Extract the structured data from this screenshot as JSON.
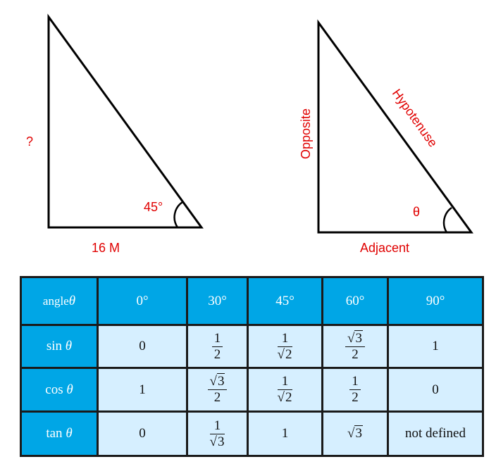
{
  "left_triangle": {
    "angle_label": "45°",
    "base_label": "16 M",
    "unknown_side_label": "?"
  },
  "right_triangle": {
    "angle_label": "θ",
    "opposite_label": "Opposite",
    "hypotenuse_label": "Hypotenuse",
    "adjacent_label": "Adjacent"
  },
  "table": {
    "header": {
      "corner": "angle",
      "corner_symbol": "θ",
      "angles": [
        "0°",
        "30°",
        "45°",
        "60°",
        "90°"
      ]
    },
    "rows": [
      {
        "fn": "sin",
        "symbol": "θ",
        "values": [
          {
            "type": "text",
            "text": "0"
          },
          {
            "type": "frac",
            "num": "1",
            "den": "2"
          },
          {
            "type": "frac",
            "num": "1",
            "den_sqrt": "2"
          },
          {
            "type": "frac",
            "num_sqrt": "3",
            "den": "2"
          },
          {
            "type": "text",
            "text": "1"
          }
        ]
      },
      {
        "fn": "cos",
        "symbol": "θ",
        "values": [
          {
            "type": "text",
            "text": "1"
          },
          {
            "type": "frac",
            "num_sqrt": "3",
            "den": "2"
          },
          {
            "type": "frac",
            "num": "1",
            "den_sqrt": "2"
          },
          {
            "type": "frac",
            "num": "1",
            "den": "2"
          },
          {
            "type": "text",
            "text": "0"
          }
        ]
      },
      {
        "fn": "tan",
        "symbol": "θ",
        "values": [
          {
            "type": "text",
            "text": "0"
          },
          {
            "type": "frac",
            "num": "1",
            "den_sqrt": "3"
          },
          {
            "type": "text",
            "text": "1"
          },
          {
            "type": "sqrt",
            "radicand": "3"
          },
          {
            "type": "text",
            "text": "not defined"
          }
        ]
      }
    ]
  }
}
